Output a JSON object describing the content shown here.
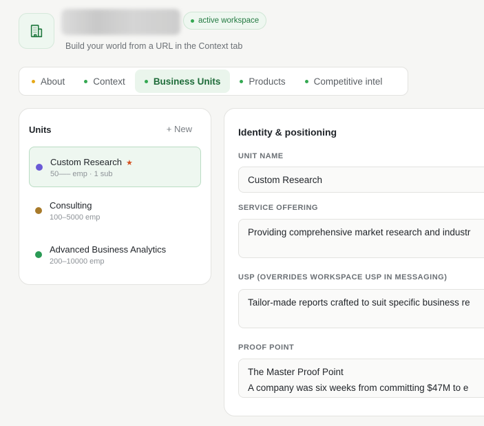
{
  "workspace": {
    "badge": "active workspace",
    "subtitle": "Build your world from a URL in the Context tab",
    "icon": "building-icon",
    "accent": "#34a852"
  },
  "tabs": [
    {
      "label": "About",
      "dot_color": "#e6a817",
      "active": false
    },
    {
      "label": "Context",
      "dot_color": "#34a852",
      "active": false
    },
    {
      "label": "Business Units",
      "dot_color": "#34a852",
      "active": true
    },
    {
      "label": "Products",
      "dot_color": "#34a852",
      "active": false
    },
    {
      "label": "Competitive intel",
      "dot_color": "#34a852",
      "active": false
    }
  ],
  "units": {
    "title": "Units",
    "new_label": "+ New",
    "items": [
      {
        "name": "Custom Research",
        "meta": "50—– emp · 1 sub",
        "color": "#6a5ad6",
        "starred": true,
        "star": "★"
      },
      {
        "name": "Consulting",
        "meta": "100–5000 emp",
        "color": "#a87a2a"
      },
      {
        "name": "Advanced Business Analytics",
        "meta": "200–10000 emp",
        "color": "#2a9a55"
      }
    ]
  },
  "identity": {
    "title": "Identity & positioning",
    "unit_name_label": "UNIT NAME",
    "unit_name": "Custom Research",
    "service_label": "SERVICE OFFERING",
    "service": "Providing comprehensive market research and industr",
    "usp_label": "USP (OVERRIDES WORKSPACE USP IN MESSAGING)",
    "usp": "Tailor-made reports crafted to suit specific business re",
    "proof_label": "PROOF POINT",
    "proof_line1": "The Master Proof Point",
    "proof_line2": "A company was six weeks from committing $47M to e"
  }
}
